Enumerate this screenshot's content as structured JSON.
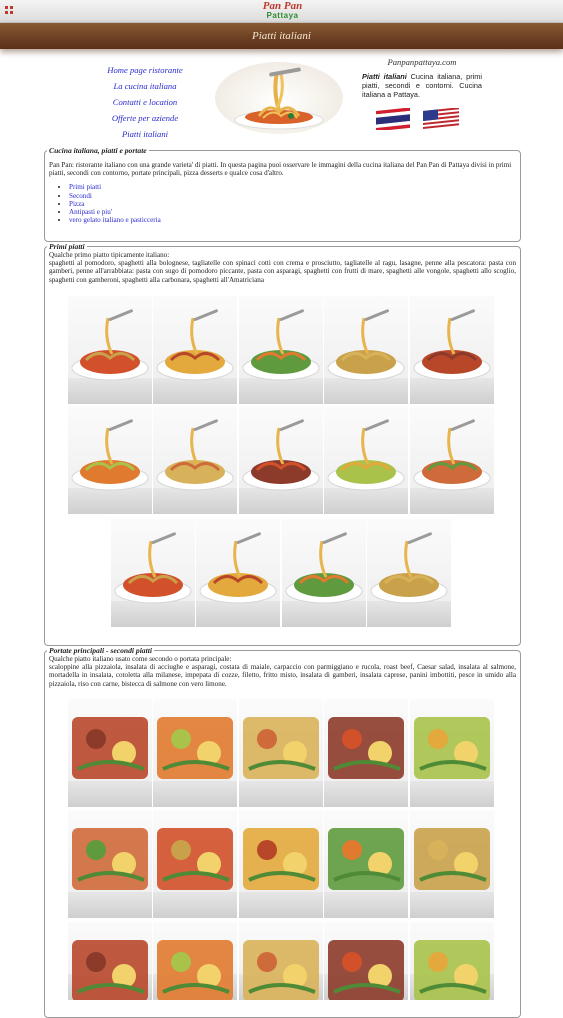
{
  "header": {
    "logo_line1": "Pan Pan",
    "logo_line2": "Pattaya",
    "banner_title": "Piatti italiani"
  },
  "nav": [
    {
      "label": "Home page ristorante"
    },
    {
      "label": "La cucina italiana"
    },
    {
      "label": "Contatti e location"
    },
    {
      "label": "Offerte per aziende"
    },
    {
      "label": "Piatti italiani"
    }
  ],
  "site": {
    "url": "Panpanpattaya.com",
    "intro_bold": "Piatti italiani",
    "intro_text": " Cucina italiana, primi piatti, secondi e contorni. Cucina italiana a Pattaya."
  },
  "section_intro": {
    "title": "Cucina italiana, piatti e portate",
    "text": "Pan Pan: ristorante italiano con una grande varieta' di piatti. In questa pagina puoi osservare le immagini della cucina italiana del Pan Pan di Pattaya divisi in primi piatti, secondi con contorno, portate principali, pizza desserts e qualce cosa d'altro.",
    "links": [
      "Primi piatti",
      "Secondi",
      "Pizza",
      "Antipasti e piu'",
      "vero gelato italiano e pasticceria"
    ]
  },
  "section_primi": {
    "title": "Primi piatti",
    "lead": "Qualche primo piatto tipicamente italiano:",
    "text": "spaghetti al pomodoro, spaghetti alla bolognese, tagliatelle con spinaci cotti con crema e prosciutto, tagliatelle al ragu, lasagne, penne alla pescatora: pasta con gamberi, penne all'arrabbiata: pasta con sugo di pomodoro piccante, pasta con asparagi, spaghetti con frutti di mare, spaghetti alle vongole, spaghetti allo scoglio, spaghetti con gamberoni, spaghetti alla carbonara, spaghetti all'Amatriciana"
  },
  "section_secondi": {
    "title": "Portate principali - secondi piatti",
    "lead": "Qualche piatto italiano usato come secondo o portata principale:",
    "text": "scaloppine alla pizzaiola, insalata di acciughe e asparagi, costata di maiale, carpaccio con parmiggiano e rucola, roast beef, Caesar salad,  insalata al salmone, mortadella in insalata, cotoletta alla milanese, impepata di cozze, filetto, fritto misto, insalata di gamberi, insalata caprese, panini imbottiti, pesce in umido alla pizzaiola, riso con carne, bistecca di salmone con vero limone."
  },
  "colors": {
    "banner": "#6b3f22",
    "link": "#2a2ad0",
    "logo_red": "#c0392b",
    "logo_green": "#2e8b2e"
  },
  "icons": [
    "menu-grid-icon",
    "thailand-flag-icon",
    "usa-flag-icon"
  ]
}
